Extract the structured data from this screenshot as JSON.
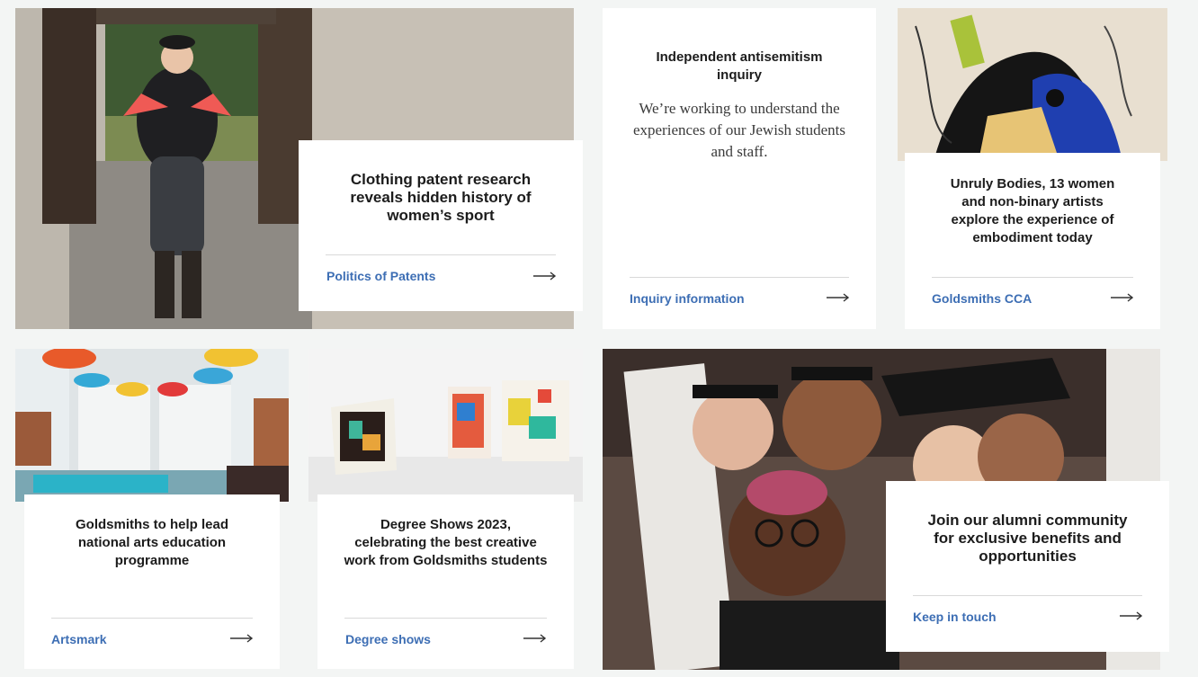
{
  "cards": [
    {
      "title": "Clothing patent research reveals hidden history of women’s sport",
      "link": "Politics of Patents"
    },
    {
      "title": "Independent antisemitism inquiry",
      "description": "We’re working to understand the experiences of our Jewish students and staff.",
      "link": "Inquiry information"
    },
    {
      "title": "Unruly Bodies, 13 women and non-binary artists explore the experience of embodiment today",
      "link": "Goldsmiths CCA"
    },
    {
      "title": "Goldsmiths to help lead national arts education programme",
      "link": "Artsmark"
    },
    {
      "title": "Degree Shows 2023, celebrating the best creative work from Goldsmiths students",
      "link": "Degree shows"
    },
    {
      "title": "Join our alumni community for exclusive benefits and opportunities",
      "link": "Keep in touch"
    }
  ],
  "icons": {
    "arrow": "long-right-arrow-icon"
  },
  "colors": {
    "link": "#3d6eb4",
    "background": "#f3f5f4",
    "card": "#ffffff"
  }
}
